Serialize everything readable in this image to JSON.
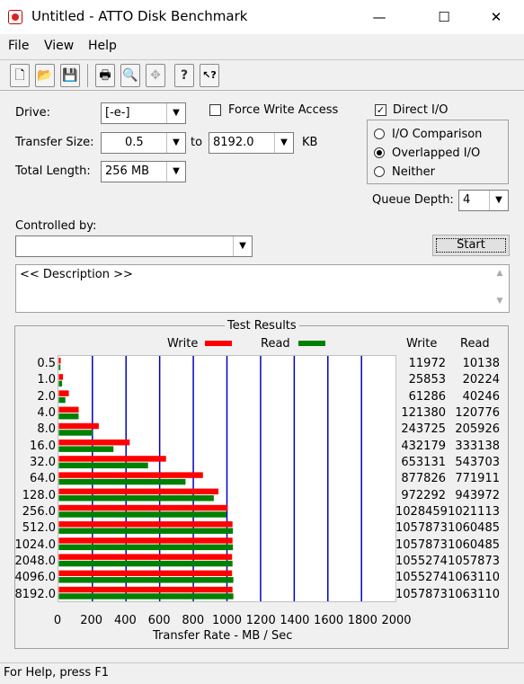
{
  "window": {
    "title": "Untitled - ATTO Disk Benchmark",
    "min_glyph": "—",
    "max_glyph": "☐",
    "close_glyph": "✕"
  },
  "menu": [
    "File",
    "View",
    "Help"
  ],
  "toolbar_icons": [
    "new-icon",
    "open-icon",
    "save-icon",
    "print-icon",
    "print-preview-icon",
    "move-icon",
    "help-icon",
    "context-help-icon"
  ],
  "toolbar_glyphs": [
    "🗋",
    "📂",
    "💾",
    "🖶",
    "🔍",
    "✥",
    "?",
    "↖?"
  ],
  "settings": {
    "drive_label": "Drive:",
    "drive_value": "[-e-]",
    "force_write_label": "Force Write Access",
    "force_write_checked": false,
    "direct_io_label": "Direct I/O",
    "direct_io_checked": true,
    "transfer_size_label": "Transfer Size:",
    "transfer_from": "0.5",
    "to_label": "to",
    "transfer_to": "8192.0",
    "kb_label": "KB",
    "total_length_label": "Total Length:",
    "total_length_value": "256 MB",
    "io_comparison_label": "I/O Comparison",
    "overlapped_io_label": "Overlapped I/O",
    "neither_label": "Neither",
    "selected_mode": "Overlapped I/O",
    "queue_depth_label": "Queue Depth:",
    "queue_depth_value": "4",
    "controlled_by_label": "Controlled by:",
    "controlled_by_value": "",
    "start_label": "Start",
    "description": "<< Description >>"
  },
  "results": {
    "title": "Test Results",
    "write_legend": "Write",
    "read_legend": "Read",
    "write_header": "Write",
    "read_header": "Read",
    "write_color": "#ff0000",
    "read_color": "#008000",
    "grid_color": "#0000c0"
  },
  "chart_data": {
    "type": "bar",
    "orientation": "horizontal",
    "categories": [
      "0.5",
      "1.0",
      "2.0",
      "4.0",
      "8.0",
      "16.0",
      "32.0",
      "64.0",
      "128.0",
      "256.0",
      "512.0",
      "1024.0",
      "2048.0",
      "4096.0",
      "8192.0"
    ],
    "series": [
      {
        "name": "Write",
        "values": [
          11972,
          25853,
          61286,
          121380,
          243725,
          432179,
          653131,
          877826,
          972292,
          1028459,
          1057873,
          1057873,
          1055274,
          1055274,
          1057873
        ]
      },
      {
        "name": "Read",
        "values": [
          10138,
          20224,
          40246,
          120776,
          205926,
          333138,
          543703,
          771911,
          943972,
          1021113,
          1060485,
          1060485,
          1057873,
          1063110,
          1063110
        ]
      }
    ],
    "write_labels": [
      "11972",
      "25853",
      "61286",
      "121380",
      "243725",
      "432179",
      "653131",
      "877826",
      "972292",
      "1028459",
      "1057873",
      "1057873",
      "1055274",
      "1055274",
      "1057873"
    ],
    "read_labels": [
      "10138",
      "20224",
      "40246",
      "120776",
      "205926",
      "333138",
      "543703",
      "771911",
      "943972",
      "1021113",
      "1060485",
      "1060485",
      "1057873",
      "1063110",
      "1063110"
    ],
    "xticks": [
      "0",
      "200",
      "400",
      "600",
      "800",
      "1000",
      "1200",
      "1400",
      "1600",
      "1800",
      "2000"
    ],
    "xlim": [
      0,
      2000
    ],
    "xlabel": "Transfer Rate - MB / Sec",
    "grid": true
  },
  "status": "For Help, press F1"
}
